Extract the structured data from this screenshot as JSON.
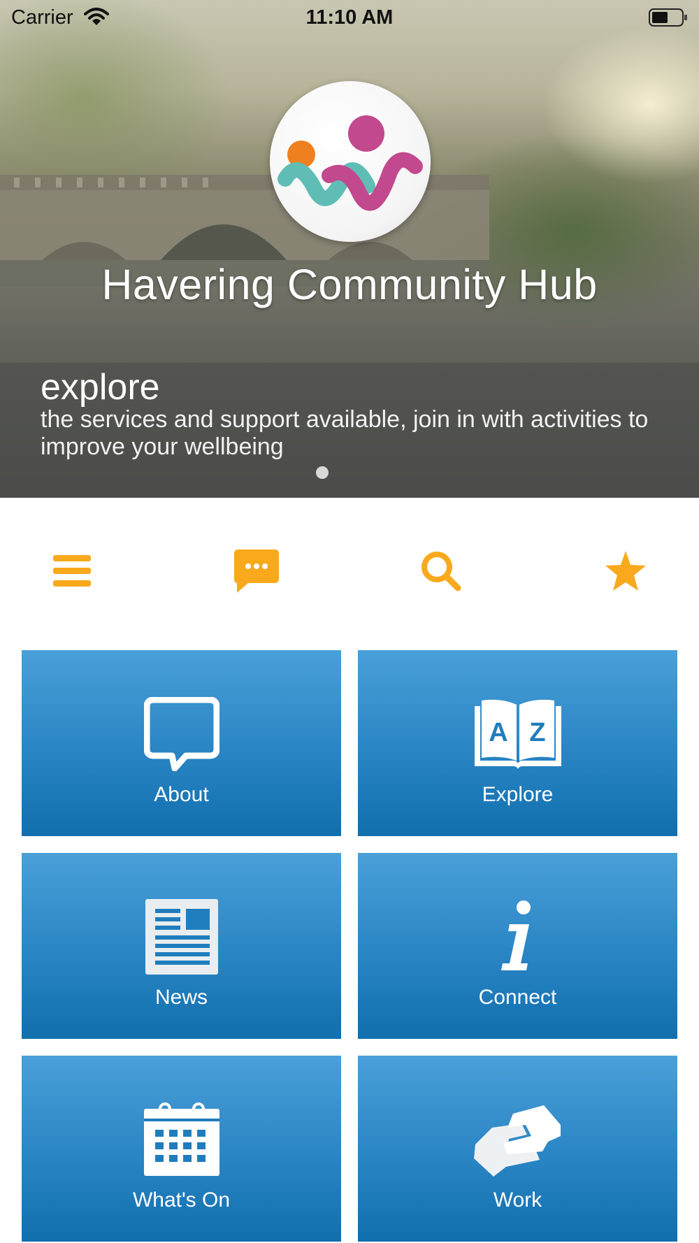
{
  "status_bar": {
    "carrier": "Carrier",
    "time": "11:10 AM"
  },
  "hero": {
    "title": "Havering Community Hub",
    "slide_heading": "explore",
    "slide_text": "the services and support available, join in with activities to improve your wellbeing",
    "page_indicator": {
      "count": 1,
      "current": 1
    }
  },
  "toolbar": {
    "items": [
      {
        "icon": "menu-icon"
      },
      {
        "icon": "chat-icon"
      },
      {
        "icon": "search-icon"
      },
      {
        "icon": "star-icon"
      }
    ]
  },
  "tiles": [
    {
      "label": "About",
      "icon": "speech-bubble-icon"
    },
    {
      "label": "Explore",
      "icon": "az-book-icon"
    },
    {
      "label": "News",
      "icon": "newspaper-icon"
    },
    {
      "label": "Connect",
      "icon": "info-icon"
    },
    {
      "label": "What's On",
      "icon": "calendar-icon"
    },
    {
      "label": "Work",
      "icon": "handshake-icon"
    }
  ],
  "colors": {
    "toolbar_icon": "#F9A91B",
    "tile_top": "#4AA0D8",
    "tile_bottom": "#116FAE",
    "logo_orange": "#EF8020",
    "logo_teal": "#5FBDB5",
    "logo_magenta": "#C2498E"
  }
}
